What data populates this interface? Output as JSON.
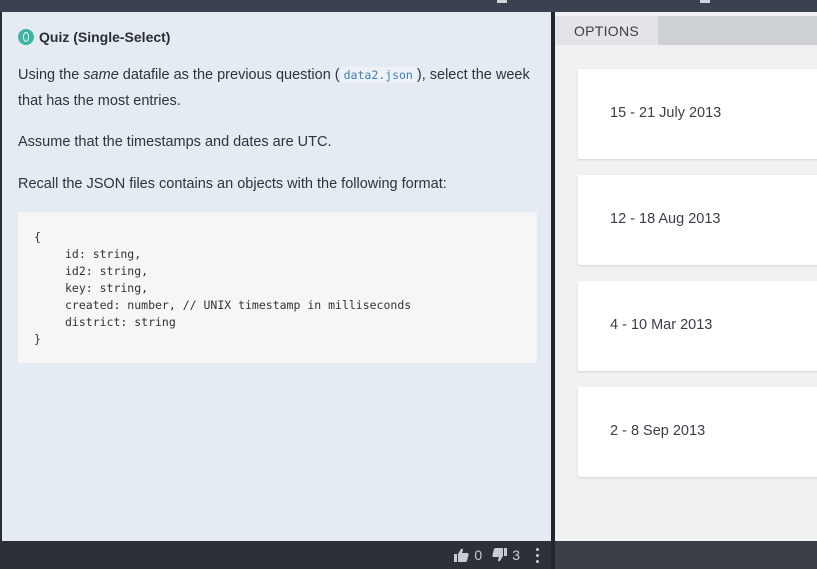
{
  "quiz": {
    "title": "Quiz (Single-Select)",
    "icon": "quiz-icon"
  },
  "question": {
    "line1_before": "Using the ",
    "line1_emph": "same",
    "line1_after": " datafile as the previous question (",
    "file_name": "data2.json",
    "line1_tail": "), select the week that has the most entries.",
    "paragraph2": "Assume that the timestamps and dates are UTC.",
    "paragraph3": "Recall the JSON files contains an objects with the following format:"
  },
  "code": {
    "open": "{",
    "line_id": "id: string,",
    "line_id2": "id2: string,",
    "line_key": "key: string,",
    "line_created": "created: number, // UNIX timestamp in milliseconds",
    "line_district": "district: string",
    "close": "}"
  },
  "options": {
    "tab_label": "OPTIONS",
    "items": [
      {
        "label": "15 - 21 July 2013"
      },
      {
        "label": "12 - 18 Aug 2013"
      },
      {
        "label": "4 - 10 Mar 2013"
      },
      {
        "label": "2 - 8 Sep 2013"
      }
    ]
  },
  "footer": {
    "upvotes": "0",
    "downvotes": "3",
    "upvote_icon": "thumbs-up-icon",
    "downvote_icon": "thumbs-down-icon",
    "more_icon": "kebab-menu-icon"
  },
  "colors": {
    "accent": "#3cb6a3",
    "code_text": "#3f7fb8",
    "left_panel_bg": "#e4ebf3",
    "right_panel_bg": "#f0f1f2"
  }
}
